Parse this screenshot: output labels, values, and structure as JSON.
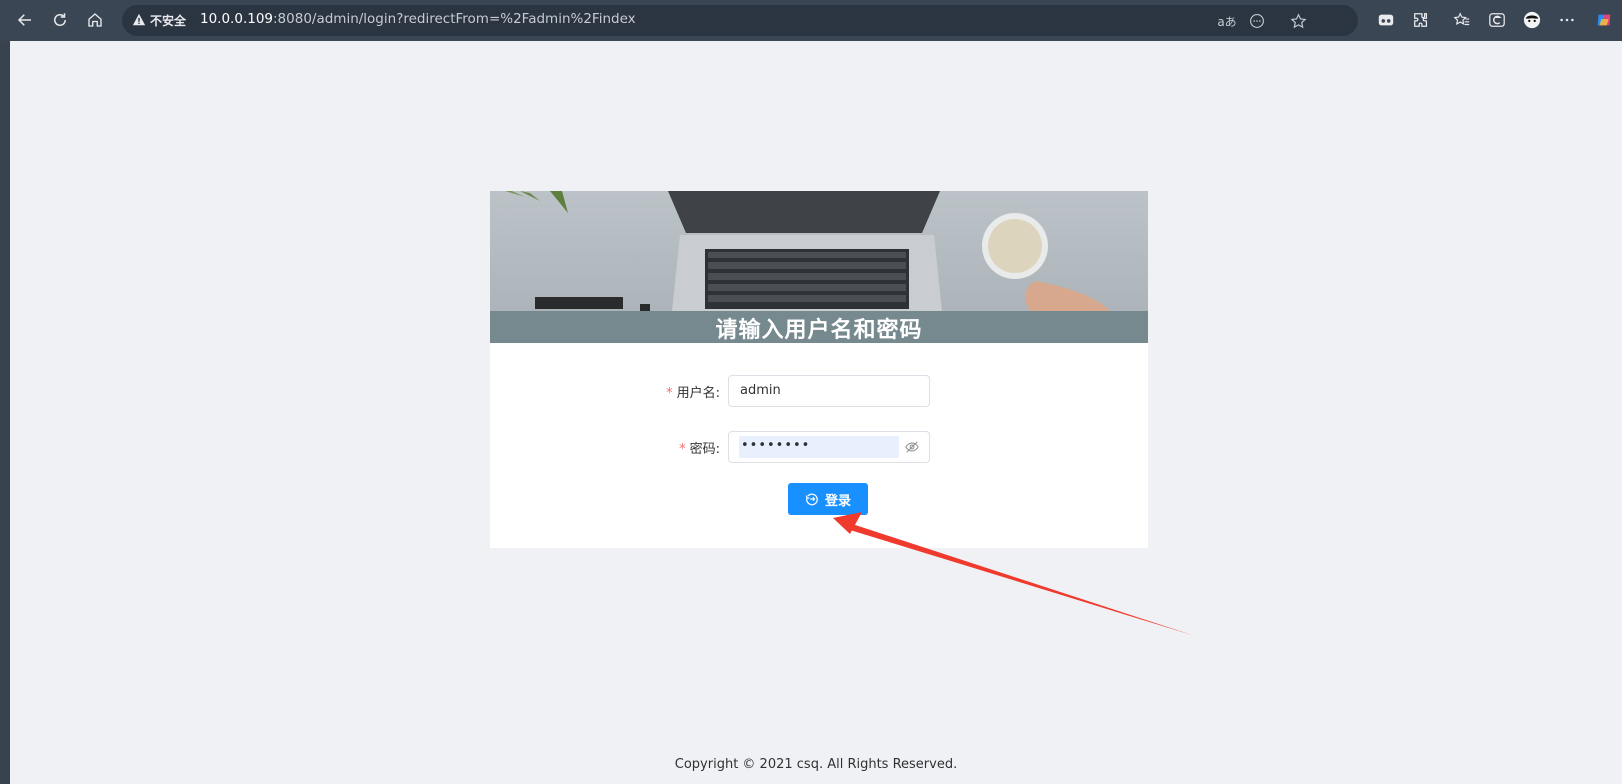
{
  "browser": {
    "security_label": "不安全",
    "url_host": "10.0.0.109",
    "url_rest": ":8080/admin/login?redirectFrom=%2Fadmin%2Findex",
    "translate_label": "aあ"
  },
  "login": {
    "banner_title": "请输入用户名和密码",
    "username_label": "用户名:",
    "username_value": "admin",
    "password_label": "密码:",
    "password_value": "••••••••",
    "required_mark": "*",
    "login_button": "登录"
  },
  "footer": {
    "copyright": "Copyright © 2021 csq. All Rights Reserved."
  },
  "colors": {
    "primary": "#1890ff",
    "required": "#f56c6c",
    "annotation_arrow": "#f03a2e"
  }
}
